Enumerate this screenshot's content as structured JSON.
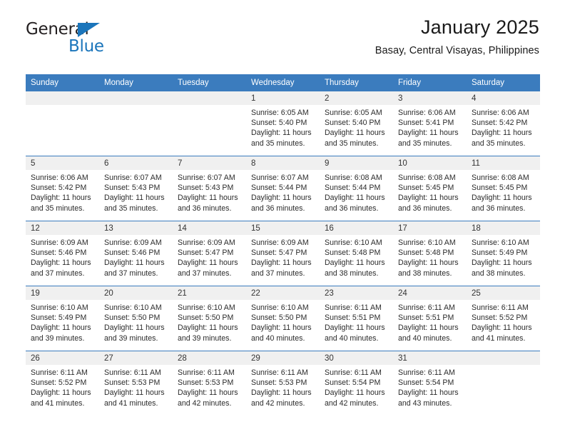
{
  "brand": {
    "name_part1": "General",
    "name_part2": "Blue",
    "triangle_color": "#1b75bb"
  },
  "header": {
    "title": "January 2025",
    "subtitle": "Basay, Central Visayas, Philippines"
  },
  "theme": {
    "header_blue": "#3b7cbe",
    "daynum_gray": "#f0f0f0",
    "text_dark": "#2b2b2b"
  },
  "calendar": {
    "weekdays": [
      "Sunday",
      "Monday",
      "Tuesday",
      "Wednesday",
      "Thursday",
      "Friday",
      "Saturday"
    ],
    "weeks": [
      [
        {
          "day": "",
          "lines": []
        },
        {
          "day": "",
          "lines": []
        },
        {
          "day": "",
          "lines": []
        },
        {
          "day": "1",
          "lines": [
            "Sunrise: 6:05 AM",
            "Sunset: 5:40 PM",
            "Daylight: 11 hours",
            "and 35 minutes."
          ]
        },
        {
          "day": "2",
          "lines": [
            "Sunrise: 6:05 AM",
            "Sunset: 5:40 PM",
            "Daylight: 11 hours",
            "and 35 minutes."
          ]
        },
        {
          "day": "3",
          "lines": [
            "Sunrise: 6:06 AM",
            "Sunset: 5:41 PM",
            "Daylight: 11 hours",
            "and 35 minutes."
          ]
        },
        {
          "day": "4",
          "lines": [
            "Sunrise: 6:06 AM",
            "Sunset: 5:42 PM",
            "Daylight: 11 hours",
            "and 35 minutes."
          ]
        }
      ],
      [
        {
          "day": "5",
          "lines": [
            "Sunrise: 6:06 AM",
            "Sunset: 5:42 PM",
            "Daylight: 11 hours",
            "and 35 minutes."
          ]
        },
        {
          "day": "6",
          "lines": [
            "Sunrise: 6:07 AM",
            "Sunset: 5:43 PM",
            "Daylight: 11 hours",
            "and 35 minutes."
          ]
        },
        {
          "day": "7",
          "lines": [
            "Sunrise: 6:07 AM",
            "Sunset: 5:43 PM",
            "Daylight: 11 hours",
            "and 36 minutes."
          ]
        },
        {
          "day": "8",
          "lines": [
            "Sunrise: 6:07 AM",
            "Sunset: 5:44 PM",
            "Daylight: 11 hours",
            "and 36 minutes."
          ]
        },
        {
          "day": "9",
          "lines": [
            "Sunrise: 6:08 AM",
            "Sunset: 5:44 PM",
            "Daylight: 11 hours",
            "and 36 minutes."
          ]
        },
        {
          "day": "10",
          "lines": [
            "Sunrise: 6:08 AM",
            "Sunset: 5:45 PM",
            "Daylight: 11 hours",
            "and 36 minutes."
          ]
        },
        {
          "day": "11",
          "lines": [
            "Sunrise: 6:08 AM",
            "Sunset: 5:45 PM",
            "Daylight: 11 hours",
            "and 36 minutes."
          ]
        }
      ],
      [
        {
          "day": "12",
          "lines": [
            "Sunrise: 6:09 AM",
            "Sunset: 5:46 PM",
            "Daylight: 11 hours",
            "and 37 minutes."
          ]
        },
        {
          "day": "13",
          "lines": [
            "Sunrise: 6:09 AM",
            "Sunset: 5:46 PM",
            "Daylight: 11 hours",
            "and 37 minutes."
          ]
        },
        {
          "day": "14",
          "lines": [
            "Sunrise: 6:09 AM",
            "Sunset: 5:47 PM",
            "Daylight: 11 hours",
            "and 37 minutes."
          ]
        },
        {
          "day": "15",
          "lines": [
            "Sunrise: 6:09 AM",
            "Sunset: 5:47 PM",
            "Daylight: 11 hours",
            "and 37 minutes."
          ]
        },
        {
          "day": "16",
          "lines": [
            "Sunrise: 6:10 AM",
            "Sunset: 5:48 PM",
            "Daylight: 11 hours",
            "and 38 minutes."
          ]
        },
        {
          "day": "17",
          "lines": [
            "Sunrise: 6:10 AM",
            "Sunset: 5:48 PM",
            "Daylight: 11 hours",
            "and 38 minutes."
          ]
        },
        {
          "day": "18",
          "lines": [
            "Sunrise: 6:10 AM",
            "Sunset: 5:49 PM",
            "Daylight: 11 hours",
            "and 38 minutes."
          ]
        }
      ],
      [
        {
          "day": "19",
          "lines": [
            "Sunrise: 6:10 AM",
            "Sunset: 5:49 PM",
            "Daylight: 11 hours",
            "and 39 minutes."
          ]
        },
        {
          "day": "20",
          "lines": [
            "Sunrise: 6:10 AM",
            "Sunset: 5:50 PM",
            "Daylight: 11 hours",
            "and 39 minutes."
          ]
        },
        {
          "day": "21",
          "lines": [
            "Sunrise: 6:10 AM",
            "Sunset: 5:50 PM",
            "Daylight: 11 hours",
            "and 39 minutes."
          ]
        },
        {
          "day": "22",
          "lines": [
            "Sunrise: 6:10 AM",
            "Sunset: 5:50 PM",
            "Daylight: 11 hours",
            "and 40 minutes."
          ]
        },
        {
          "day": "23",
          "lines": [
            "Sunrise: 6:11 AM",
            "Sunset: 5:51 PM",
            "Daylight: 11 hours",
            "and 40 minutes."
          ]
        },
        {
          "day": "24",
          "lines": [
            "Sunrise: 6:11 AM",
            "Sunset: 5:51 PM",
            "Daylight: 11 hours",
            "and 40 minutes."
          ]
        },
        {
          "day": "25",
          "lines": [
            "Sunrise: 6:11 AM",
            "Sunset: 5:52 PM",
            "Daylight: 11 hours",
            "and 41 minutes."
          ]
        }
      ],
      [
        {
          "day": "26",
          "lines": [
            "Sunrise: 6:11 AM",
            "Sunset: 5:52 PM",
            "Daylight: 11 hours",
            "and 41 minutes."
          ]
        },
        {
          "day": "27",
          "lines": [
            "Sunrise: 6:11 AM",
            "Sunset: 5:53 PM",
            "Daylight: 11 hours",
            "and 41 minutes."
          ]
        },
        {
          "day": "28",
          "lines": [
            "Sunrise: 6:11 AM",
            "Sunset: 5:53 PM",
            "Daylight: 11 hours",
            "and 42 minutes."
          ]
        },
        {
          "day": "29",
          "lines": [
            "Sunrise: 6:11 AM",
            "Sunset: 5:53 PM",
            "Daylight: 11 hours",
            "and 42 minutes."
          ]
        },
        {
          "day": "30",
          "lines": [
            "Sunrise: 6:11 AM",
            "Sunset: 5:54 PM",
            "Daylight: 11 hours",
            "and 42 minutes."
          ]
        },
        {
          "day": "31",
          "lines": [
            "Sunrise: 6:11 AM",
            "Sunset: 5:54 PM",
            "Daylight: 11 hours",
            "and 43 minutes."
          ]
        },
        {
          "day": "",
          "lines": []
        }
      ]
    ]
  }
}
